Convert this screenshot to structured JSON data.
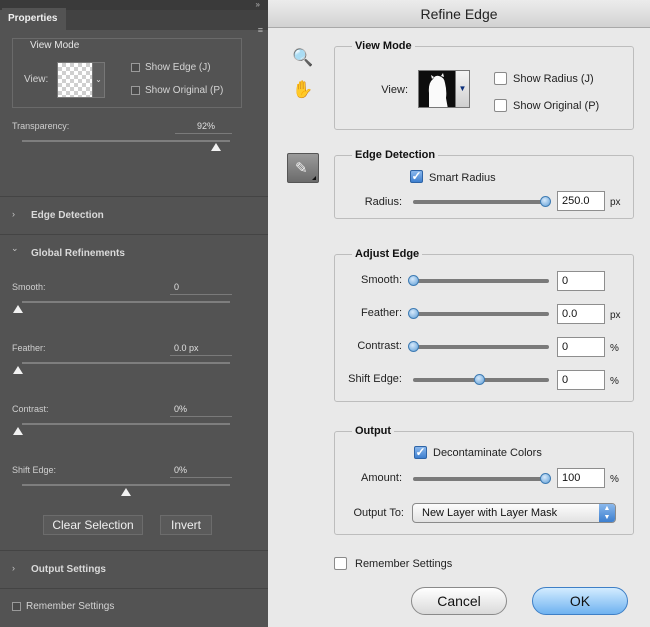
{
  "properties_panel": {
    "tab_title": "Properties",
    "collapse_glyph": "»",
    "menu_glyph": "≡",
    "view_mode": {
      "title": "View Mode",
      "view_label": "View:",
      "show_edge": "Show Edge (J)",
      "show_original": "Show Original (P)"
    },
    "transparency": {
      "label": "Transparency:",
      "value": "92%",
      "level": 0.92
    },
    "sections": {
      "edge_detection": "Edge Detection",
      "global_refinements": "Global Refinements",
      "output_settings": "Output Settings"
    },
    "sliders": {
      "smooth": {
        "label": "Smooth:",
        "value": "0",
        "level": 0
      },
      "feather": {
        "label": "Feather:",
        "value": "0.0 px",
        "level": 0
      },
      "contrast": {
        "label": "Contrast:",
        "value": "0%",
        "level": 0
      },
      "shift_edge": {
        "label": "Shift Edge:",
        "value": "0%",
        "level": 0.5
      }
    },
    "buttons": {
      "clear_selection": "Clear Selection",
      "invert": "Invert"
    },
    "remember_settings": "Remember Settings",
    "arrow_collapsed": "›",
    "arrow_expanded": "⌄"
  },
  "refine_edge": {
    "title": "Refine Edge",
    "view_mode": {
      "title": "View Mode",
      "view_label": "View:",
      "show_radius": "Show Radius (J)",
      "show_original": "Show Original (P)"
    },
    "edge_detection": {
      "title": "Edge Detection",
      "smart_radius": "Smart Radius",
      "smart_radius_checked": true,
      "radius_label": "Radius:",
      "radius_value": "250.0",
      "radius_unit": "px",
      "radius_level": 1.0
    },
    "adjust_edge": {
      "title": "Adjust Edge",
      "smooth": {
        "label": "Smooth:",
        "value": "0",
        "unit": "",
        "level": 0
      },
      "feather": {
        "label": "Feather:",
        "value": "0.0",
        "unit": "px",
        "level": 0
      },
      "contrast": {
        "label": "Contrast:",
        "value": "0",
        "unit": "%",
        "level": 0
      },
      "shift_edge": {
        "label": "Shift Edge:",
        "value": "0",
        "unit": "%",
        "level": 0.5
      }
    },
    "output": {
      "title": "Output",
      "decontaminate": "Decontaminate Colors",
      "decontaminate_checked": true,
      "amount_label": "Amount:",
      "amount_value": "100",
      "amount_unit": "%",
      "amount_level": 1.0,
      "output_to_label": "Output To:",
      "output_to_value": "New Layer with Layer Mask"
    },
    "remember_settings": "Remember Settings",
    "buttons": {
      "cancel": "Cancel",
      "ok": "OK"
    },
    "check_glyph": "✓",
    "tools": {
      "zoom": "🔍",
      "hand": "✋",
      "brush": "✎"
    }
  },
  "colors": {
    "panel_bg": "#535353",
    "dialog_bg": "#e9e9e9",
    "accent_blue": "#3d7fcf"
  }
}
